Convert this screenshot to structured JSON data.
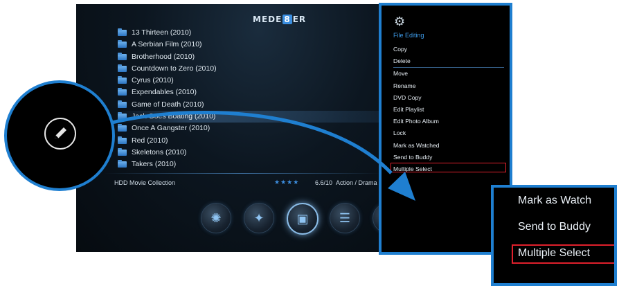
{
  "app": {
    "logo_text": [
      "M",
      "E",
      "D",
      "E",
      "8",
      "E",
      "R"
    ]
  },
  "file_list": {
    "items": [
      {
        "label": "13 Thirteen (2010)",
        "selected": false
      },
      {
        "label": "A Serbian Film (2010)",
        "selected": false
      },
      {
        "label": "Brotherhood (2010)",
        "selected": false
      },
      {
        "label": "Countdown to Zero (2010)",
        "selected": false
      },
      {
        "label": "Cyrus (2010)",
        "selected": false
      },
      {
        "label": "Expendables (2010)",
        "selected": false
      },
      {
        "label": "Game of Death (2010)",
        "selected": false
      },
      {
        "label": "Jack Goes Boating (2010)",
        "selected": true
      },
      {
        "label": "Once A Gangster (2010)",
        "selected": false
      },
      {
        "label": "Red (2010)",
        "selected": false
      },
      {
        "label": "Skeletons (2010)",
        "selected": false
      },
      {
        "label": "Takers (2010)",
        "selected": false
      }
    ]
  },
  "footer": {
    "collection": "HDD Movie Collection",
    "stars": "★★★★",
    "rating": "6.6/10",
    "genre": "Action / Drama"
  },
  "dock": {
    "buttons": [
      {
        "name": "film-reel-button",
        "icon": "film-reel-icon",
        "glyph": "✺"
      },
      {
        "name": "network-button",
        "icon": "network-icon",
        "glyph": "✦"
      },
      {
        "name": "media-button",
        "icon": "media-icon",
        "glyph": "▣"
      },
      {
        "name": "list-button",
        "icon": "list-icon",
        "glyph": "☰"
      },
      {
        "name": "menu-button",
        "icon": "menu-icon",
        "glyph": "☰"
      }
    ]
  },
  "context_menu": {
    "title": "File Editing",
    "icon": "gear-icon",
    "items": [
      "Copy",
      "Delete",
      "Move",
      "Rename",
      "DVD Copy",
      "Edit Playlist",
      "Edit Photo Album",
      "Lock",
      "Mark as Watched",
      "Send to Buddy",
      "Multiple Select"
    ],
    "highlighted": "Multiple Select"
  },
  "zoom": {
    "items": [
      "Mark as Watch",
      "Send to Buddy",
      "Multiple Select"
    ]
  },
  "colors": {
    "accent": "#1f7fd0",
    "highlight_border": "#e0202c",
    "menu_title": "#3e9be8"
  }
}
